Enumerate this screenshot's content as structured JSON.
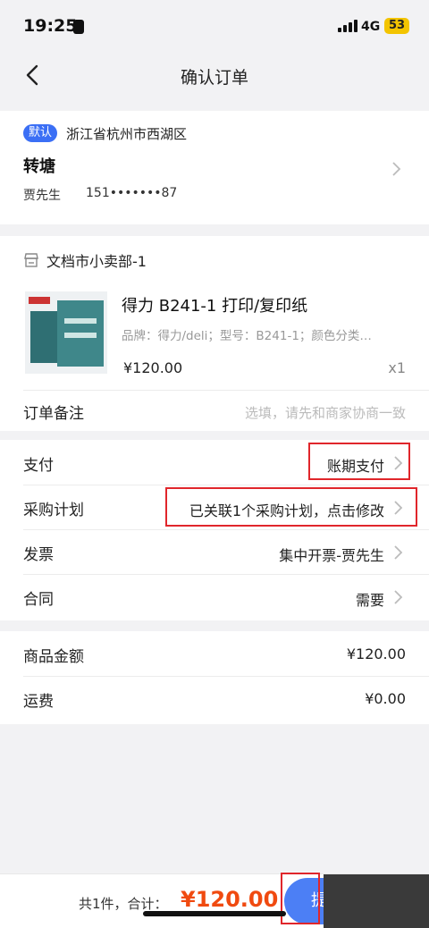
{
  "status": {
    "time": "19:25",
    "network": "4G",
    "battery": "53"
  },
  "nav": {
    "title": "确认订单"
  },
  "address": {
    "badge": "默认",
    "region": "浙江省杭州市西湖区",
    "street": "转塘",
    "contact_name": "贾先生",
    "phone": "151•••••••87"
  },
  "shop": {
    "name": "文档市小卖部-1",
    "product": {
      "name": "得力 B241-1 打印/复印纸",
      "spec": "品牌：得力/deli；型号：B241-1；颜色分类…",
      "price": "¥120.00",
      "qty": "x1"
    },
    "note": {
      "label": "订单备注",
      "placeholder": "选填，请先和商家协商一致"
    }
  },
  "options": [
    {
      "label": "支付",
      "value": "账期支付"
    },
    {
      "label": "采购计划",
      "value": "已关联1个采购计划，点击修改"
    },
    {
      "label": "发票",
      "value": "集中开票-贾先生"
    },
    {
      "label": "合同",
      "value": "需要"
    }
  ],
  "summary": [
    {
      "label": "商品金额",
      "value": "¥120.00"
    },
    {
      "label": "运费",
      "value": "¥0.00"
    }
  ],
  "footer": {
    "total_label": "共1件，合计：",
    "total_value": "¥120.00",
    "submit_label": "提"
  },
  "colors": {
    "accent": "#4c7ff5",
    "price": "#f04a10",
    "highlight": "#e0262b"
  }
}
